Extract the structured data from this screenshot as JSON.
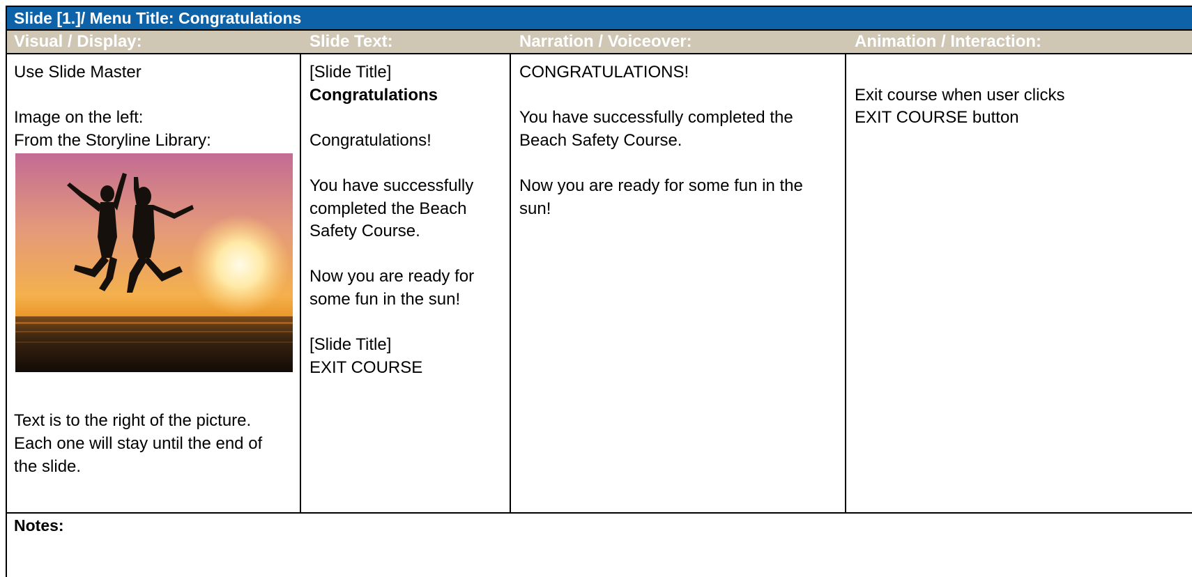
{
  "title_bar": "Slide [1.]/ Menu Title: Congratulations",
  "headers": {
    "visual": "Visual / Display:",
    "slide_text": "Slide Text:",
    "narration": "Narration / Voiceover:",
    "animation": "Animation / Interaction:"
  },
  "visual_col": {
    "line1": "Use Slide Master",
    "line2": "Image on the left:",
    "line3": "From the Storyline Library:",
    "note1": "Text is  to the right of the picture.",
    "note2": "Each one will stay until the end of",
    "note3": "the slide."
  },
  "slide_text_col": {
    "title_tag": "[Slide Title]",
    "title": "Congratulations",
    "heading": "Congratulations!",
    "p1_l1": "You have successfully",
    "p1_l2": "completed the Beach",
    "p1_l3": "Safety Course.",
    "p2_l1": "Now you are ready for",
    "p2_l2": "some fun in the sun!",
    "title_tag2": "[Slide Title]",
    "exit": "EXIT COURSE"
  },
  "narration_col": {
    "l1": "CONGRATULATIONS!",
    "l2": "You have successfully completed the",
    "l3": "Beach Safety Course.",
    "l4": "Now you are ready for some fun in the",
    "l5": "sun!"
  },
  "animation_col": {
    "l1": "Exit course when user clicks",
    "l2": "EXIT COURSE button"
  },
  "notes_label": "Notes:"
}
